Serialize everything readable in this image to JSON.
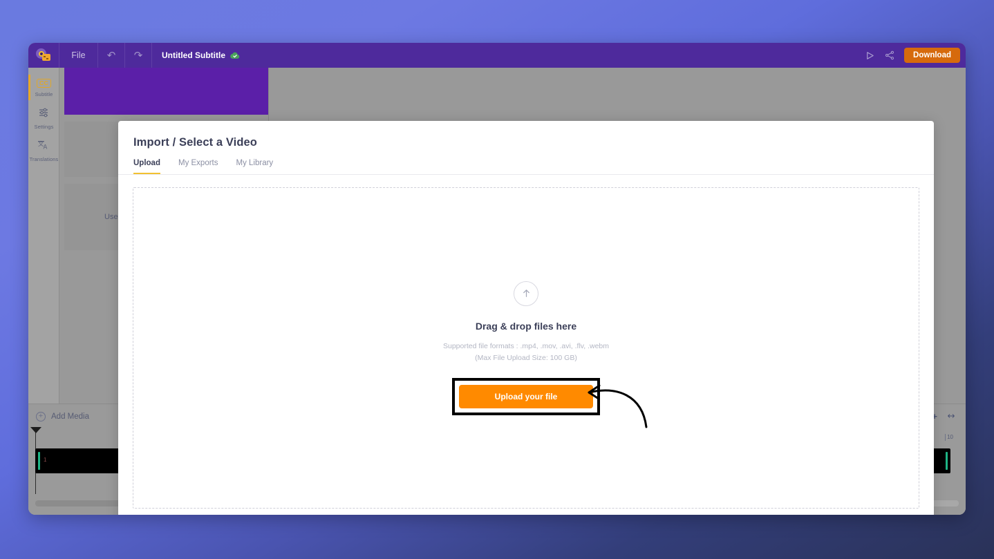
{
  "topbar": {
    "logo_icon": "app-logo-icon",
    "file_menu": "File",
    "undo_icon": "↶",
    "redo_icon": "↷",
    "doc_title": "Untitled Subtitle",
    "cloud_status_icon": "cloud-saved-icon",
    "preview_icon": "▷",
    "share_icon": "share-icon",
    "download_label": "Download",
    "download_color": "#d66a0d"
  },
  "sidebar": {
    "items": [
      {
        "label": "Subtitle",
        "icon": "cc-icon",
        "active": true
      },
      {
        "label": "Settings",
        "icon": "sliders-icon",
        "active": false
      },
      {
        "label": "Translations",
        "icon": "translate-icon",
        "active": false
      }
    ]
  },
  "left_panel": {
    "card_text": "Use a"
  },
  "media_bar": {
    "add_media_label": "Add Media",
    "add_media_icon": "plus-circle-icon",
    "zoom_plus_icon": "+",
    "fit_icon": "↔"
  },
  "timeline": {
    "ruler_ticks": [
      "10"
    ],
    "track_number": "1",
    "handle_icon": "drag-dots-icon"
  },
  "modal": {
    "title": "Import / Select a Video",
    "tabs": [
      {
        "label": "Upload",
        "active": true
      },
      {
        "label": "My Exports",
        "active": false
      },
      {
        "label": "My Library",
        "active": false
      }
    ],
    "dropzone": {
      "upload_arrow_icon": "↑",
      "heading": "Drag & drop files here",
      "formats_line": "Supported file formats : .mp4, .mov, .avi, .flv, .webm",
      "size_line": "(Max File Upload Size: 100 GB)",
      "upload_button_label": "Upload your file",
      "upload_button_color": "#ff8a00"
    }
  },
  "annotation": {
    "arrow_icon": "curved-arrow-annotation"
  }
}
